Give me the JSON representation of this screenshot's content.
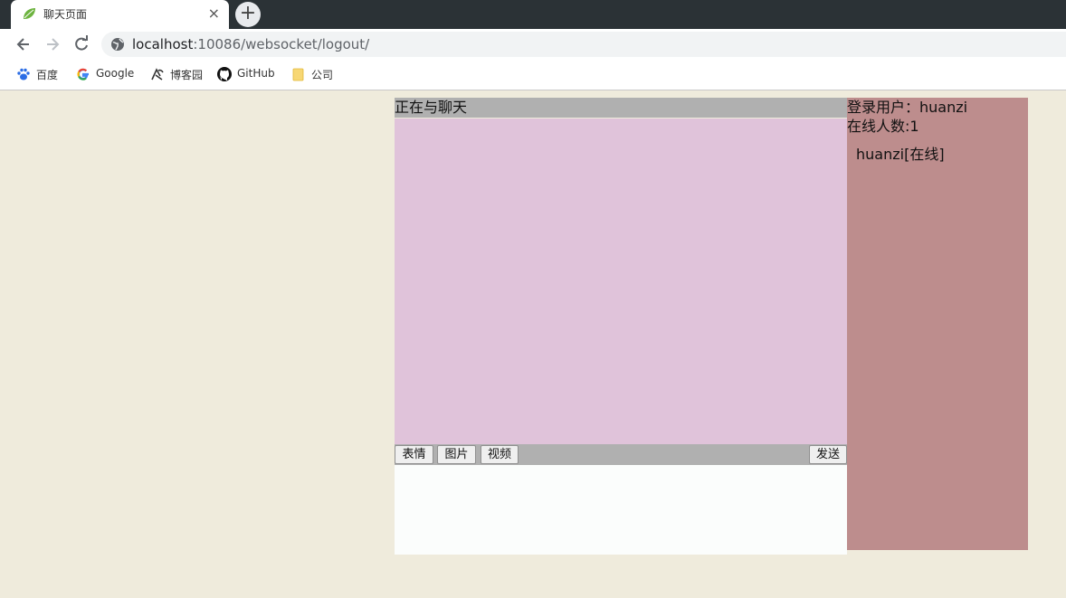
{
  "browser": {
    "tab": {
      "title": "聊天页面",
      "close": "×"
    },
    "new_tab": "+",
    "url": {
      "host": "localhost",
      "rest": ":10086/websocket/logout/"
    },
    "bookmarks": [
      {
        "label": "百度",
        "icon": "baidu-paw-icon"
      },
      {
        "label": "Google",
        "icon": "google-g-icon"
      },
      {
        "label": "博客园",
        "icon": "cnblogs-icon"
      },
      {
        "label": "GitHub",
        "icon": "github-icon"
      },
      {
        "label": "公司",
        "icon": "folder-icon"
      }
    ]
  },
  "chat": {
    "header": "正在与聊天",
    "tools": {
      "emoji": "表情",
      "image": "图片",
      "video": "视频",
      "send": "发送"
    },
    "input_value": ""
  },
  "sidebar": {
    "login_user": "登录用户：huanzi",
    "online_count": "在线人数:1",
    "online_users": [
      "huanzi[在线]"
    ]
  },
  "colors": {
    "page_bg": "#efebdc",
    "chat_header_bg": "#b0b0b0",
    "message_area_bg": "#e0c3da",
    "input_bg": "#fbfdfc",
    "sidebar_bg": "#bd8d8d"
  }
}
